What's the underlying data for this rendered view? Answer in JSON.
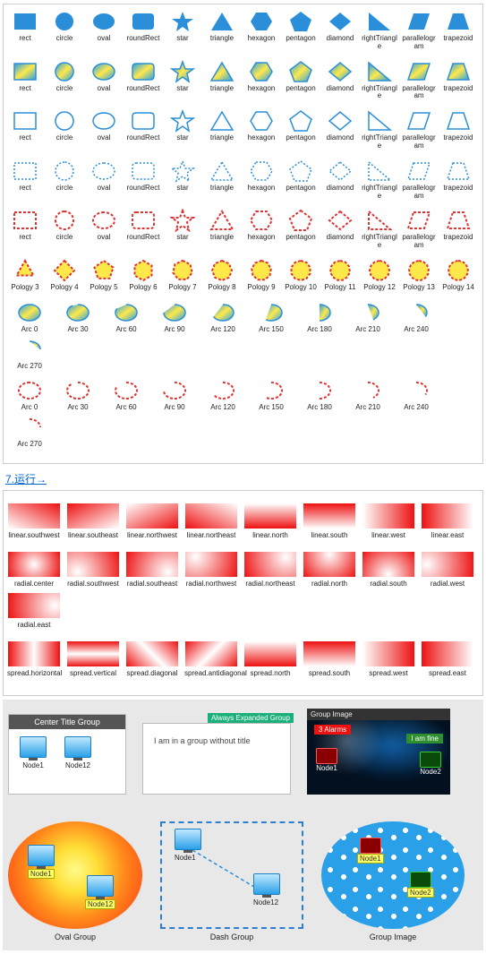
{
  "shape_names": [
    "rect",
    "circle",
    "oval",
    "roundRect",
    "star",
    "triangle",
    "hexagon",
    "pentagon",
    "diamond",
    "rightTriangle",
    "parallelogram",
    "trapezoid"
  ],
  "polygon_labels": [
    "Pology 3",
    "Pology 4",
    "Pology 5",
    "Pology 6",
    "Pology 7",
    "Pology 8",
    "Pology 9",
    "Pology 10",
    "Pology 11",
    "Pology 12",
    "Pology 13",
    "Pology 14"
  ],
  "arc_labels": [
    "Arc 0",
    "Arc 30",
    "Arc 60",
    "Arc 90",
    "Arc 120",
    "Arc 150",
    "Arc 180",
    "Arc 210",
    "Arc 240",
    "Arc 270"
  ],
  "run_link": "7.运行→",
  "gradients_linear": [
    "linear.southwest",
    "linear.southeast",
    "linear.northwest",
    "linear.northeast",
    "linear.north",
    "linear.south",
    "linear.west",
    "linear.east"
  ],
  "gradients_radial": [
    "radial.center",
    "radial.southwest",
    "radial.southeast",
    "radial.northwest",
    "radial.northeast",
    "radial.north",
    "radial.south",
    "radial.west",
    "radial.east"
  ],
  "gradients_spread": [
    "spread.horizontal",
    "spread.vertical",
    "spread.diagonal",
    "spread.antidiagonal",
    "spread.north",
    "spread.south",
    "spread.west",
    "spread.east"
  ],
  "center_title_group": {
    "title": "Center Title Group",
    "nodes": [
      "Node1",
      "Node12"
    ]
  },
  "untitled_group": {
    "text": "I am in a group without title",
    "tag": "Always Expanded Group"
  },
  "image_group": {
    "title": "Group Image",
    "alarm": "3 Alarms",
    "fine": "I am fine",
    "nodes": [
      "Node1",
      "Node2"
    ]
  },
  "oval_group": {
    "label": "Oval Group",
    "nodes": [
      "Node1",
      "Node12"
    ]
  },
  "dash_group": {
    "label": "Dash Group",
    "nodes": [
      "Node1",
      "Node12"
    ]
  },
  "pattern_group": {
    "label": "Group Image",
    "nodes": [
      "Node1",
      "Node2"
    ]
  },
  "colors": {
    "blue": "#2a8fd8",
    "yellow": "#ffe84a",
    "red": "#e11"
  }
}
